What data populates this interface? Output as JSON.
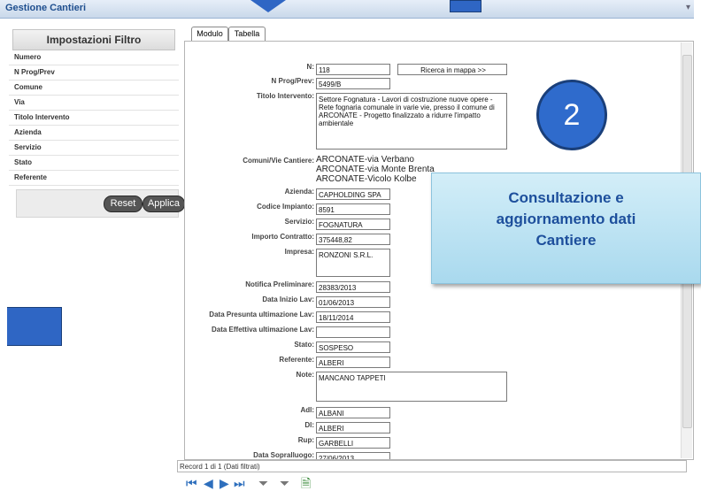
{
  "window": {
    "title": "Gestione Cantieri"
  },
  "filter": {
    "title": "Impostazioni Filtro",
    "rows": [
      "Numero",
      "N Prog/Prev",
      "Comune",
      "Via",
      "Titolo Intervento",
      "Azienda",
      "Servizio",
      "Stato",
      "Referente"
    ],
    "reset_label": "Reset",
    "apply_label": "Applica"
  },
  "tabs": {
    "modulo": "Modulo",
    "tabella": "Tabella"
  },
  "form": {
    "n_label": "N:",
    "n_value": "118",
    "map_button": "Ricerca in mappa >>",
    "nprog_label": "N Prog/Prev:",
    "nprog_value": "5499/B",
    "titolo_label": "Titolo Intervento:",
    "titolo_value": "Settore Fognatura - Lavori di costruzione nuove opere - Rete fognaria comunale in varie vie, presso il comune di ARCONATE - Progetto finalizzato a ridurre l'impatto ambientale",
    "comuni_label": "Comuni/Vie Cantiere:",
    "comuni_values": [
      "ARCONATE-via Verbano",
      "ARCONATE-via Monte Brenta",
      "ARCONATE-Vicolo Kolbe"
    ],
    "azienda_label": "Azienda:",
    "azienda_value": "CAPHOLDING SPA",
    "codice_label": "Codice Impianto:",
    "codice_value": "8591",
    "servizio_label": "Servizio:",
    "servizio_value": "FOGNATURA",
    "importo_label": "Importo Contratto:",
    "importo_value": "375448,82",
    "impresa_label": "Impresa:",
    "impresa_value": "RONZONI S.R.L.",
    "notifica_label": "Notifica Preliminare:",
    "notifica_value": "28383/2013",
    "inizio_label": "Data Inizio Lav:",
    "inizio_value": "01/06/2013",
    "presunta_label": "Data Presunta ultimazione Lav:",
    "presunta_value": "18/11/2014",
    "effettiva_label": "Data Effettiva ultimazione Lav:",
    "effettiva_value": "",
    "stato_label": "Stato:",
    "stato_value": "SOSPESO",
    "referente_label": "Referente:",
    "referente_value": "ALBERI",
    "note_label": "Note:",
    "note_value": "MANCANO TAPPETI",
    "adl_label": "Adl:",
    "adl_value": "ALBANI",
    "dl_label": "Dl:",
    "dl_value": "ALBERI",
    "rup_label": "Rup:",
    "rup_value": "GARBELLI",
    "sopralluogo_label": "Data Sopralluogo:",
    "sopralluogo_value": "27/06/2013"
  },
  "status": {
    "text": "Record 1 di 1 (Dati filtrati)"
  },
  "callout": {
    "number": "2",
    "text_lines": [
      "Consultazione e",
      "aggiornamento dati",
      "Cantiere"
    ]
  },
  "colors": {
    "accent": "#2f6bcc",
    "title": "#1f4f8f",
    "callout_text": "#1d4f9c"
  }
}
